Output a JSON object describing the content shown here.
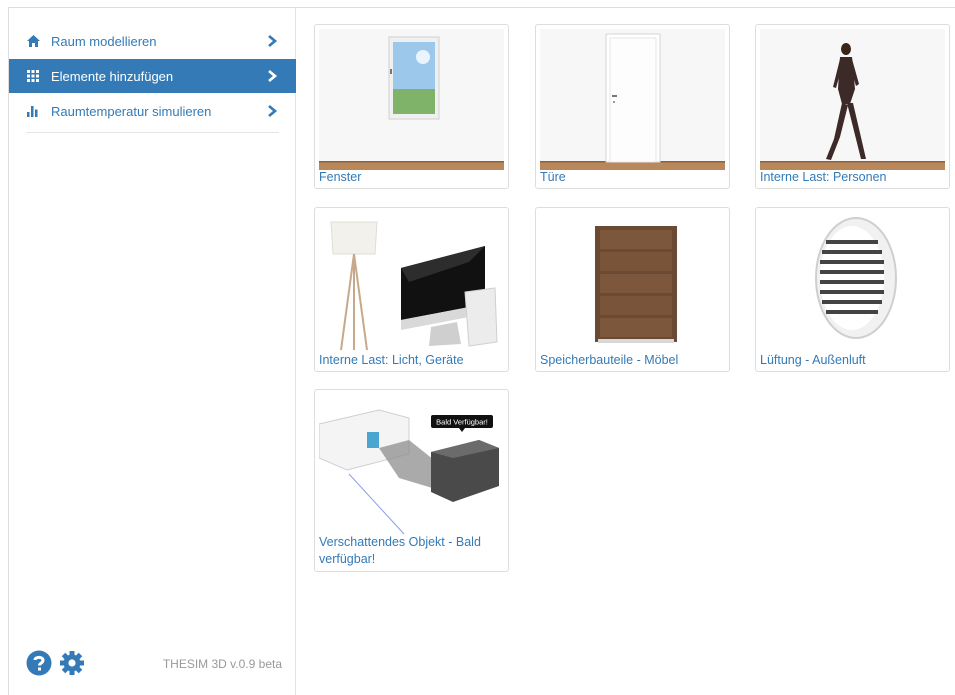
{
  "sidebar": {
    "items": [
      {
        "label": "Raum modellieren",
        "icon": "home-icon",
        "active": false
      },
      {
        "label": "Elemente hinzufügen",
        "icon": "grid-icon",
        "active": true
      },
      {
        "label": "Raumtemperatur simulieren",
        "icon": "bar-chart-icon",
        "active": false
      }
    ],
    "footer": {
      "help_icon": "help-icon",
      "settings_icon": "gear-icon",
      "version": "THESIM 3D v.0.9 beta"
    }
  },
  "cards": [
    {
      "label": "Fenster",
      "image": "window-image"
    },
    {
      "label": "Türe",
      "image": "door-image"
    },
    {
      "label": "Interne Last: Personen",
      "image": "person-image"
    },
    {
      "label": "Interne Last: Licht, Geräte",
      "image": "lamp-computer-image"
    },
    {
      "label": "Speicherbauteile - Möbel",
      "image": "dresser-image"
    },
    {
      "label": "Lüftung - Außenluft",
      "image": "vent-image"
    },
    {
      "label": "Verschattendes Objekt - Bald verfügbar!",
      "image": "shading-object-image",
      "badge": "Bald Verfügbar!"
    }
  ],
  "colors": {
    "accent": "#337ab7",
    "border": "#dddddd",
    "wood": "#b8875a"
  }
}
